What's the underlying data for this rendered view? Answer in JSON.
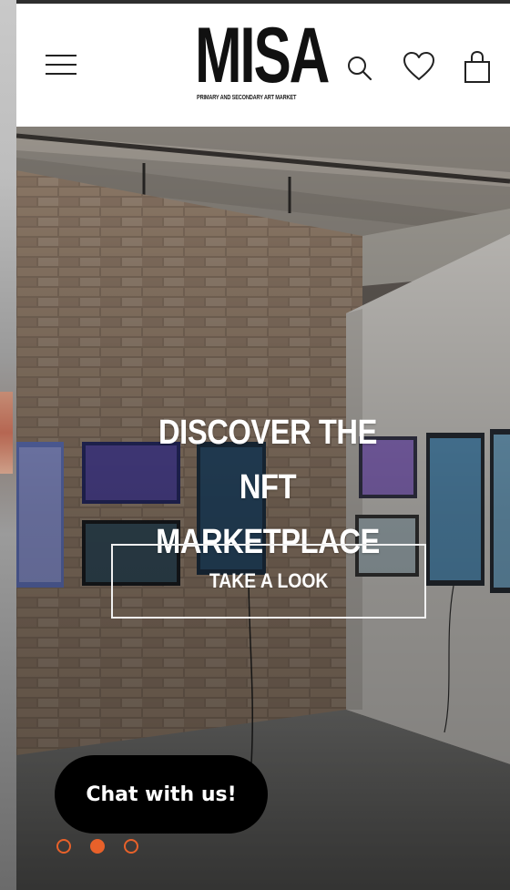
{
  "header": {
    "logo_text": "MISA",
    "logo_tagline": "PRIMARY AND SECONDARY ART MARKET",
    "icons": [
      "menu-icon",
      "search-icon",
      "heart-icon",
      "shopping-bag-icon"
    ]
  },
  "hero": {
    "title": "DISCOVER THE NFT MARKETPLACE",
    "cta_label": "TAKE A LOOK",
    "slides_total": 3,
    "active_slide": 2
  },
  "chat": {
    "label": "Chat with us!"
  },
  "colors": {
    "accent": "#e8612a",
    "chat_bg": "#000000",
    "header_bg": "#ffffff"
  }
}
